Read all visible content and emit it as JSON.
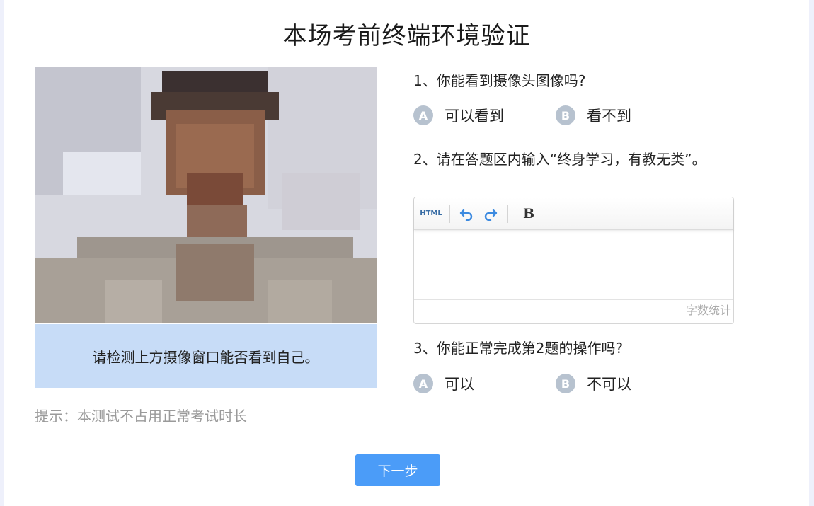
{
  "page": {
    "title": "本场考前终端环境验证"
  },
  "camera_panel": {
    "caption": "请检测上方摄像窗口能否看到自己。",
    "hint": "提示：本测试不占用正常考试时长"
  },
  "questions": {
    "q1": {
      "text": "1、你能看到摄像头图像吗?",
      "options": [
        {
          "badge": "A",
          "label": "可以看到"
        },
        {
          "badge": "B",
          "label": "看不到"
        }
      ]
    },
    "q2": {
      "text": "2、请在答题区内输入“终身学习，有教无类”。",
      "editor": {
        "html_button": "HTML",
        "bold_button": "B",
        "word_count_label": "字数统计"
      }
    },
    "q3": {
      "text": "3、你能正常完成第2题的操作吗?",
      "options": [
        {
          "badge": "A",
          "label": "可以"
        },
        {
          "badge": "B",
          "label": "不可以"
        }
      ]
    }
  },
  "footer": {
    "next_button": "下一步"
  },
  "colors": {
    "accent": "#4b9cf8",
    "caption_bg": "#c7dcf7",
    "badge": "#b7c2cf",
    "hint_text": "#9a9a9a"
  }
}
